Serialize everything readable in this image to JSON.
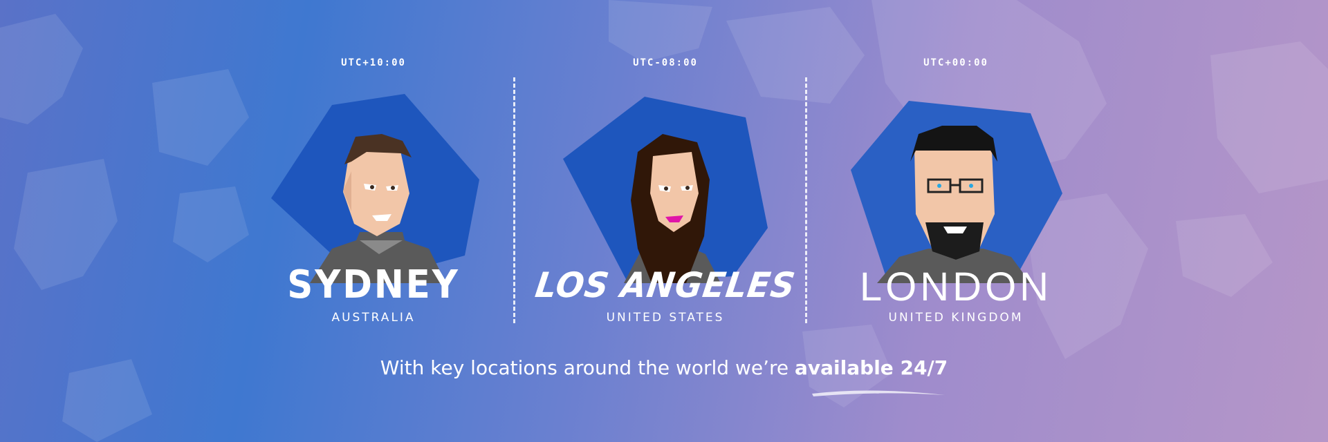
{
  "locations": [
    {
      "utc": "UTC+10:00",
      "city": "SYDNEY",
      "country": "AUSTRALIA"
    },
    {
      "utc": "UTC-08:00",
      "city": "LOS ANGELES",
      "country": "UNITED STATES"
    },
    {
      "utc": "UTC+00:00",
      "city": "LONDON",
      "country": "UNITED KINGDOM"
    }
  ],
  "tagline": {
    "text": "With key locations around the world we’re ",
    "emphasis": "available 24/7"
  },
  "colors": {
    "hexagon": "#1e56bd",
    "shirt": "#5a5a5a",
    "skin": "#f2c6a8"
  },
  "icons": [
    "world-map-background",
    "sydney-avatar",
    "los-angeles-avatar",
    "london-avatar"
  ]
}
